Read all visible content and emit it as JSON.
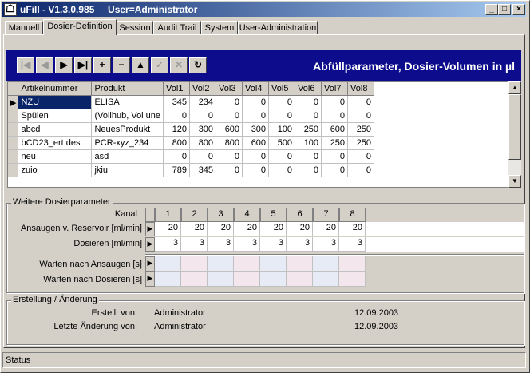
{
  "window": {
    "title": "uFill - V1.3.0.985     User=Administrator"
  },
  "tabs": [
    "Manuell",
    "Dosier-Definition",
    "Session",
    "Audit Trail",
    "System",
    "User-Administration"
  ],
  "navbar": {
    "title": "Abfüllparameter, Dosier-Volumen in µl",
    "buttons": [
      {
        "name": "first-record-icon",
        "glyph": "|◀",
        "enabled": false
      },
      {
        "name": "prior-record-icon",
        "glyph": "◀",
        "enabled": false
      },
      {
        "name": "next-record-icon",
        "glyph": "▶",
        "enabled": true
      },
      {
        "name": "last-record-icon",
        "glyph": "▶|",
        "enabled": true
      },
      {
        "name": "insert-record-icon",
        "glyph": "+",
        "enabled": true
      },
      {
        "name": "delete-record-icon",
        "glyph": "−",
        "enabled": true
      },
      {
        "name": "edit-record-icon",
        "glyph": "▲",
        "enabled": true
      },
      {
        "name": "post-record-icon",
        "glyph": "✓",
        "enabled": false
      },
      {
        "name": "cancel-record-icon",
        "glyph": "✕",
        "enabled": false
      },
      {
        "name": "refresh-icon",
        "glyph": "↻",
        "enabled": true
      }
    ]
  },
  "grid": {
    "columns": [
      "Artikelnummer",
      "Produkt",
      "Vol1",
      "Vol2",
      "Vol3",
      "Vol4",
      "Vol5",
      "Vol6",
      "Vol7",
      "Vol8"
    ],
    "rows": [
      [
        "NZU",
        "ELISA",
        "345",
        "234",
        "0",
        "0",
        "0",
        "0",
        "0",
        "0"
      ],
      [
        "Spülen",
        "(Vollhub, Vol une",
        "0",
        "0",
        "0",
        "0",
        "0",
        "0",
        "0",
        "0"
      ],
      [
        "abcd",
        "NeuesProdukt",
        "120",
        "300",
        "600",
        "300",
        "100",
        "250",
        "600",
        "250"
      ],
      [
        "bCD23_ert des",
        "PCR-xyz_234",
        "800",
        "800",
        "800",
        "600",
        "500",
        "100",
        "250",
        "250"
      ],
      [
        "neu",
        "asd",
        "0",
        "0",
        "0",
        "0",
        "0",
        "0",
        "0",
        "0"
      ],
      [
        "zuio",
        "jkiu",
        "789",
        "345",
        "0",
        "0",
        "0",
        "0",
        "0",
        "0"
      ]
    ]
  },
  "params": {
    "group_title": "Weitere Dosierparameter",
    "kanal_label": "Kanal",
    "channels": [
      "1",
      "2",
      "3",
      "4",
      "5",
      "6",
      "7",
      "8"
    ],
    "rows": [
      {
        "label": "Ansaugen v. Reservoir [ml/min]",
        "values": [
          "20",
          "20",
          "20",
          "20",
          "20",
          "20",
          "20",
          "20"
        ]
      },
      {
        "label": "Dosieren [ml/min]",
        "values": [
          "3",
          "3",
          "3",
          "3",
          "3",
          "3",
          "3",
          "3"
        ]
      },
      {
        "label": "Warten nach Ansaugen [s]",
        "values": [
          "",
          "",
          "",
          "",
          "",
          "",
          "",
          ""
        ]
      },
      {
        "label": "Warten nach Dosieren [s]",
        "values": [
          "",
          "",
          "",
          "",
          "",
          "",
          "",
          ""
        ]
      }
    ]
  },
  "creation": {
    "group_title": "Erstellung / Änderung",
    "created_label": "Erstellt von:",
    "created_user": "Administrator",
    "created_date": "12.09.2003",
    "changed_label": "Letzte Änderung von:",
    "changed_user": "Administrator",
    "changed_date": "12.09.2003"
  },
  "status": {
    "text": "Status"
  }
}
